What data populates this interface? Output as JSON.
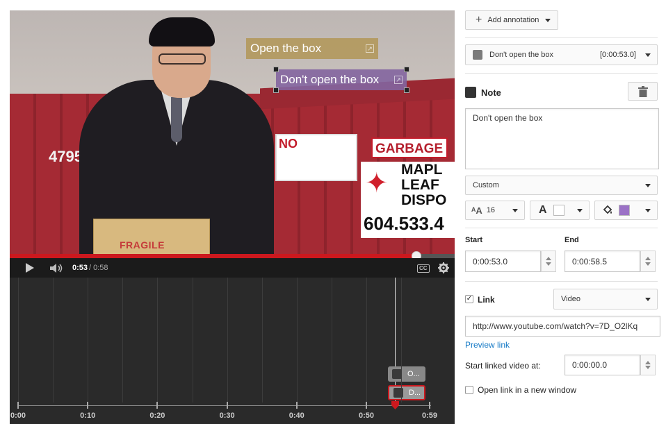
{
  "video": {
    "scene_texts": {
      "fragile": "FRAGILE",
      "garbage": "GARBAGE",
      "no": "NO",
      "maple": "MAPL",
      "leaf": "LEAF",
      "dispo": "DISPO",
      "phone": "604.533.4",
      "number": "4795"
    },
    "annotations": [
      {
        "text": "Open the box",
        "color": "#b29757"
      },
      {
        "text": "Don't open the box",
        "color": "#8365a0"
      }
    ]
  },
  "player": {
    "time_current": "0:53",
    "time_duration": "/ 0:58",
    "progress_fraction": 0.914,
    "icons": [
      "play-icon",
      "volume-icon",
      "captions-icon",
      "gear-icon"
    ],
    "cc_label": "CC"
  },
  "timeline": {
    "labels": [
      "0:00",
      "0:10",
      "0:20",
      "0:30",
      "0:40",
      "0:50",
      "0:59"
    ],
    "items": [
      {
        "label": "O..."
      },
      {
        "label": "D..."
      }
    ]
  },
  "panel": {
    "add_annotation_label": "Add annotation",
    "selected_annotation": {
      "label": "Don't open the box",
      "time": "[0:00:53.0]"
    },
    "type_label": "Note",
    "text_value": "Don't open the box",
    "style_select": "Custom",
    "font_size": "16",
    "text_color": "#ffffff",
    "bg_color": "#9b72c6",
    "start_label": "Start",
    "start_value": "0:00:53.0",
    "end_label": "End",
    "end_value": "0:00:58.5",
    "link_label": "Link",
    "link_checked": true,
    "link_type": "Video",
    "link_url": "http://www.youtube.com/watch?v=7D_O2lKq",
    "preview_link": "Preview link",
    "start_linked_label": "Start linked video at:",
    "start_linked_value": "0:00:00.0",
    "new_window_label": "Open link in a new window"
  }
}
